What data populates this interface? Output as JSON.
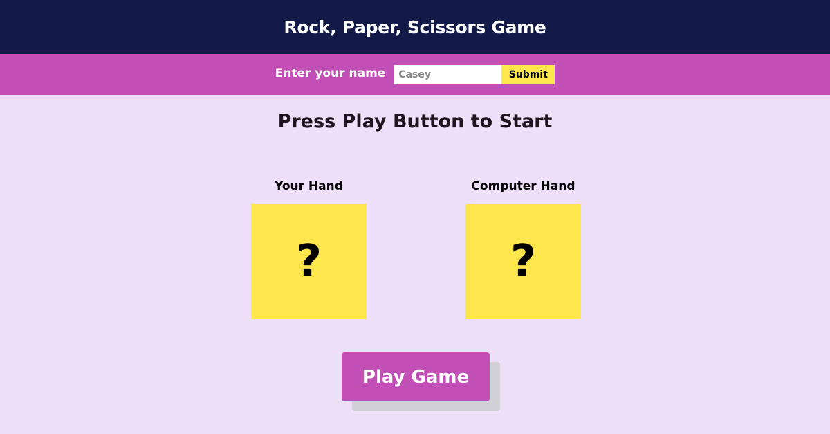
{
  "header": {
    "title": "Rock, Paper, Scissors Game"
  },
  "name_form": {
    "label": "Enter your name",
    "input_value": "Casey",
    "submit_label": "Submit"
  },
  "status": {
    "message": "Press Play Button to Start"
  },
  "hands": {
    "player": {
      "title": "Your Hand",
      "symbol": "?"
    },
    "computer": {
      "title": "Computer Hand",
      "symbol": "?"
    }
  },
  "play_button": {
    "label": "Play Game"
  },
  "colors": {
    "header_bg": "#131a47",
    "name_bar_bg": "#c24fb5",
    "page_bg": "#efe0fa",
    "hand_box_bg": "#fde74c",
    "submit_bg": "#fde74c",
    "play_button_bg": "#c24fb5"
  }
}
